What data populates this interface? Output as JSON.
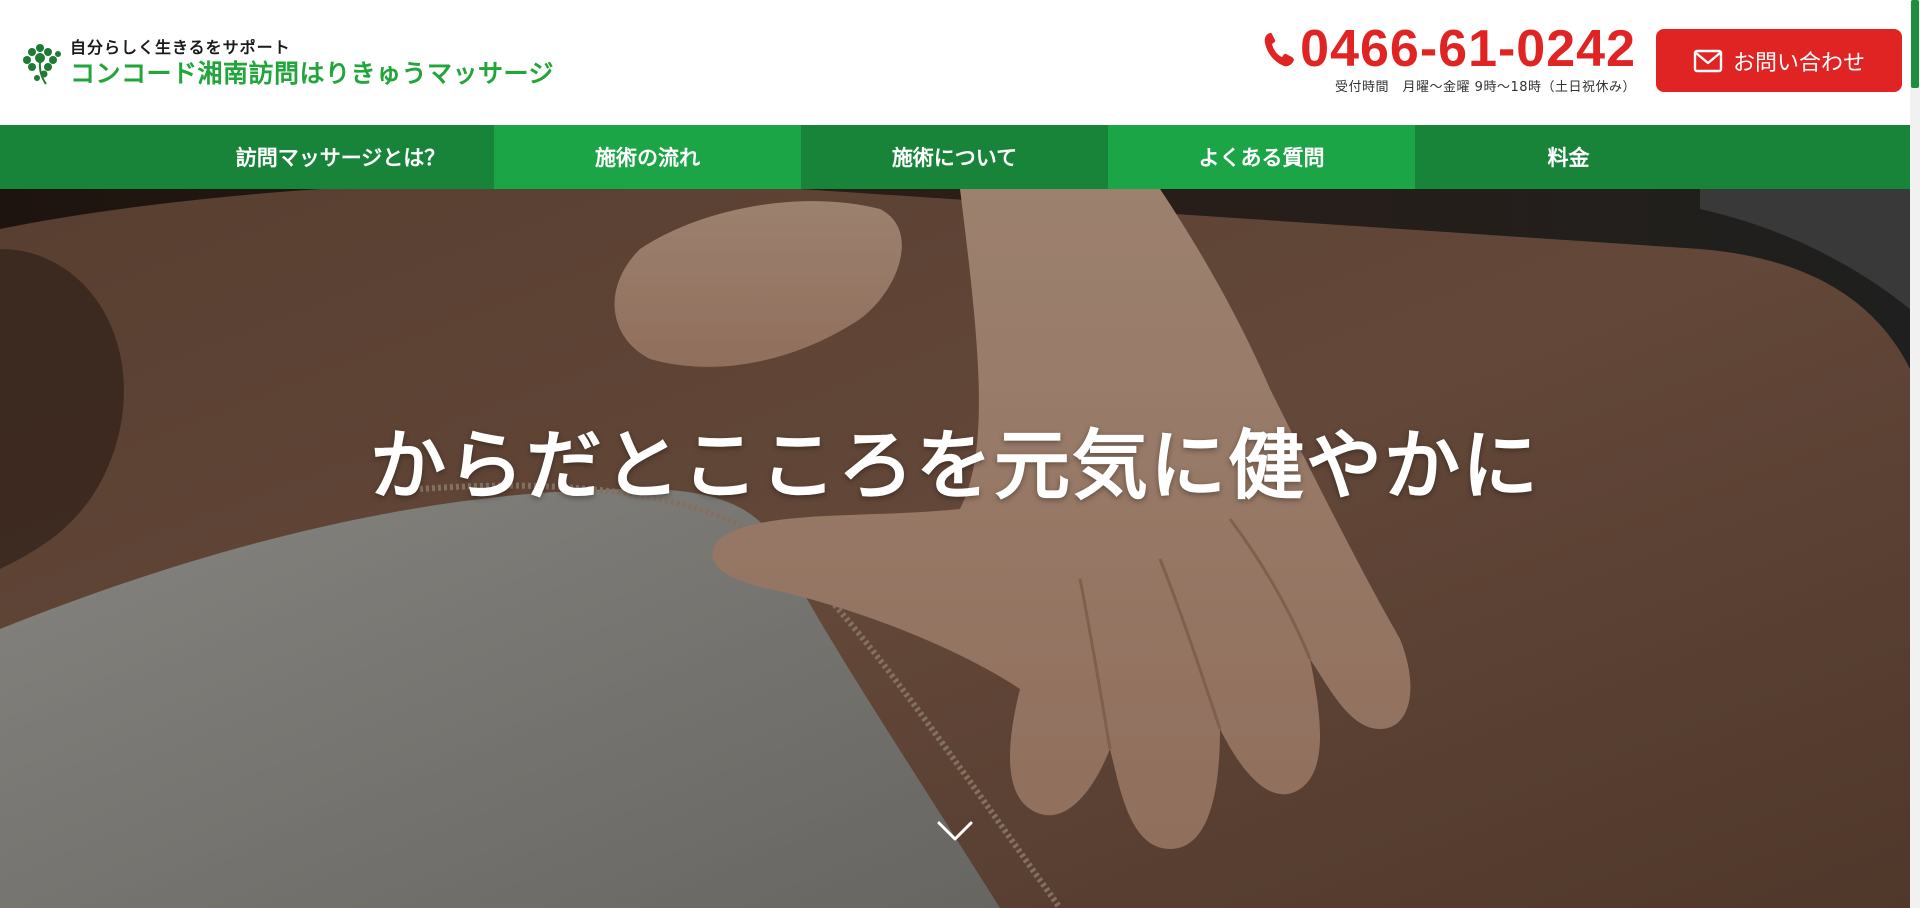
{
  "header": {
    "tagline": "自分らしく生きるをサポート",
    "brand_name": "コンコード湘南訪問はりきゅうマッサージ",
    "phone": "0466-61-0242",
    "hours": "受付時間　月曜～金曜 9時～18時（土日祝休み）",
    "inquiry_label": "お問い合わせ"
  },
  "nav": {
    "items": [
      {
        "label": "訪問マッサージとは？"
      },
      {
        "label": "施術の流れ"
      },
      {
        "label": "施術について"
      },
      {
        "label": "よくある質問"
      },
      {
        "label": "料金"
      }
    ]
  },
  "hero": {
    "title": "からだとこころを元気に健やかに"
  },
  "colors": {
    "brand_green": "#22a53a",
    "nav_green": "#17843a",
    "nav_green_alt": "#1ca546",
    "accent_red": "#e02424"
  },
  "icons": {
    "logo": "clover-logo-icon",
    "phone": "phone-icon",
    "mail": "mail-icon",
    "scroll": "chevron-down-icon"
  }
}
